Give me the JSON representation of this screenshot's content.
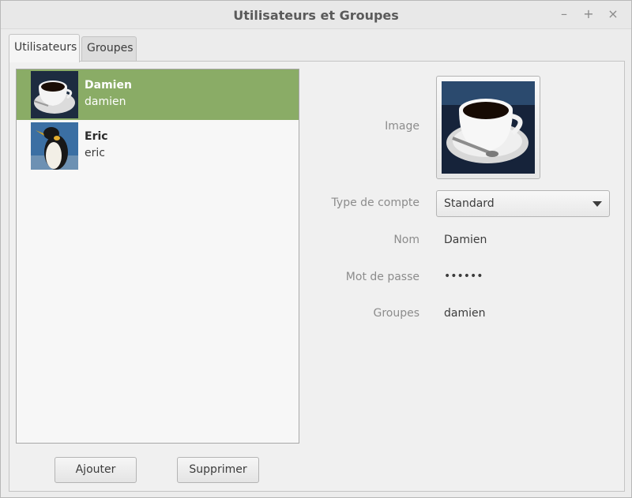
{
  "window": {
    "title": "Utilisateurs et Groupes",
    "controls": {
      "minimize": "–",
      "maximize": "+",
      "close": "×"
    }
  },
  "tabs": [
    {
      "label": "Utilisateurs",
      "active": true
    },
    {
      "label": "Groupes",
      "active": false
    }
  ],
  "users": [
    {
      "name": "Damien",
      "login": "damien",
      "avatar": "coffee-cup-icon",
      "selected": true
    },
    {
      "name": "Eric",
      "login": "eric",
      "avatar": "penguin-icon",
      "selected": false
    }
  ],
  "buttons": {
    "add": "Ajouter",
    "delete": "Supprimer"
  },
  "form": {
    "image_label": "Image",
    "account_type_label": "Type de compte",
    "account_type_value": "Standard",
    "name_label": "Nom",
    "name_value": "Damien",
    "password_label": "Mot de passe",
    "password_value": "••••••",
    "groups_label": "Groupes",
    "groups_value": "damien"
  },
  "colors": {
    "selection": "#8aac66"
  }
}
